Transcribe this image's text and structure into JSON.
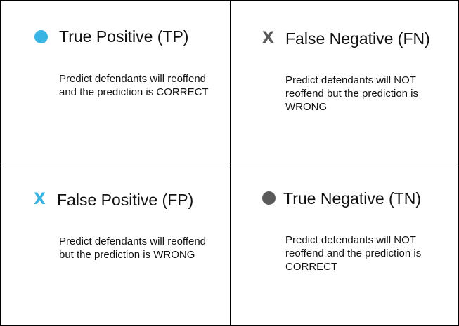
{
  "colors": {
    "positive": "#3ab4e2",
    "negative": "#5a5a5a"
  },
  "cells": {
    "tp": {
      "icon": "circle-icon",
      "title": "True Positive (TP)",
      "description": "Predict defendants will reoffend and the prediction is CORRECT"
    },
    "fn": {
      "icon": "x-icon",
      "icon_glyph": "X",
      "title": "False Negative (FN)",
      "description": "Predict defendants will NOT reoffend but the prediction is WRONG"
    },
    "fp": {
      "icon": "x-icon",
      "icon_glyph": "X",
      "title": "False Positive (FP)",
      "description": "Predict defendants will reoffend but the prediction is WRONG"
    },
    "tn": {
      "icon": "circle-icon",
      "title": "True Negative (TN)",
      "description": "Predict defendants will NOT reoffend and the prediction is CORRECT"
    }
  }
}
